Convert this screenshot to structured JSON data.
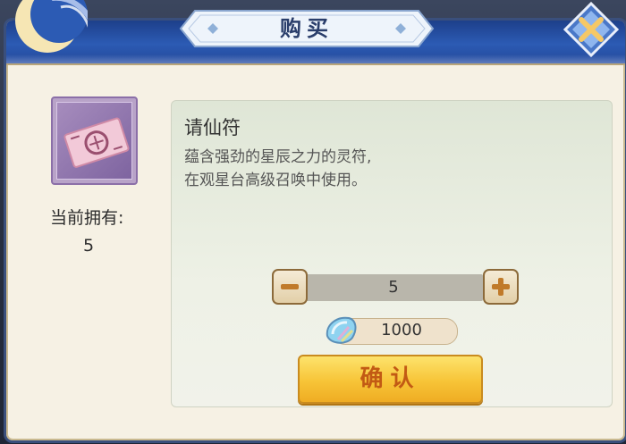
{
  "dialog": {
    "title": "购买",
    "close_icon": "close-x-icon"
  },
  "item": {
    "icon": "talisman-icon",
    "owned_label": "当前拥有:",
    "owned_count": "5",
    "name": "请仙符",
    "desc_line1": "蕴含强劲的星辰之力的灵符,",
    "desc_line2": "在观星台高级召唤中使用。"
  },
  "quantity": {
    "value": "5",
    "minus_icon": "minus-icon",
    "plus_icon": "plus-icon"
  },
  "price": {
    "currency_icon": "gem-icon",
    "value": "1000"
  },
  "confirm_label": "确认",
  "colors": {
    "header": "#2c5bb4",
    "panel": "#e6eadc",
    "confirm": "#f7c437",
    "confirm_text": "#c25a14"
  }
}
